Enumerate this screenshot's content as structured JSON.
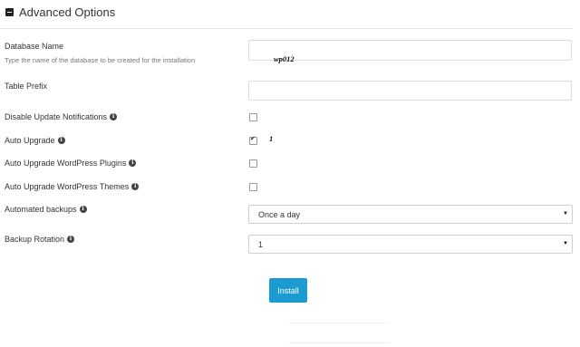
{
  "header": {
    "title": "Advanced Options",
    "icon": "minus-square-icon"
  },
  "fields": {
    "database_name": {
      "label": "Database Name",
      "hint": "Type the name of the database to be created for the installation",
      "value": "wp012"
    },
    "table_prefix": {
      "label": "Table Prefix",
      "value": ""
    },
    "disable_update_notifications": {
      "label": "Disable Update Notifications",
      "checked": false
    },
    "auto_upgrade": {
      "label": "Auto Upgrade",
      "checked": true,
      "value_text": "1"
    },
    "auto_upgrade_plugins": {
      "label": "Auto Upgrade WordPress Plugins",
      "checked": false
    },
    "auto_upgrade_themes": {
      "label": "Auto Upgrade WordPress Themes",
      "checked": false
    },
    "automated_backups": {
      "label": "Automated backups",
      "selected": "Once a day"
    },
    "backup_rotation": {
      "label": "Backup Rotation",
      "selected": "1"
    }
  },
  "actions": {
    "install_label": "Install"
  },
  "colors": {
    "accent": "#1b9bd1",
    "border": "#dcdcdc",
    "text": "#333333"
  }
}
